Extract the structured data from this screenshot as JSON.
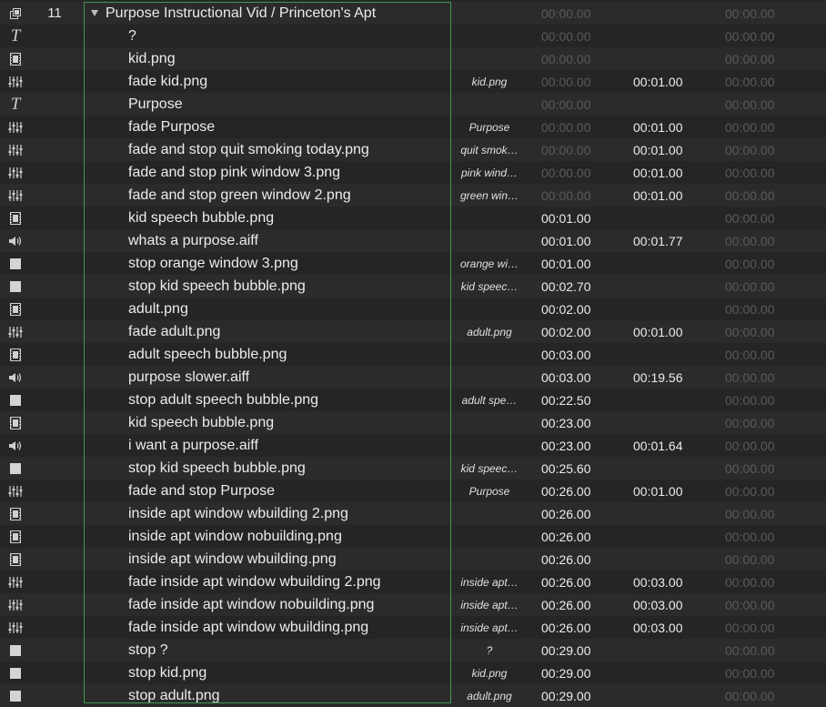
{
  "group_border_color": "#3f9a4e",
  "rows": [
    {
      "icon": "group-icon",
      "number": "11",
      "name": "Purpose Instructional Vid / Princeton's Apt",
      "target": "",
      "pre_wait": "00:00.00",
      "pre_dim": true,
      "action": "",
      "post_wait": "00:00.00",
      "post_dim": true,
      "group": true
    },
    {
      "icon": "text-icon",
      "number": "",
      "name": "?",
      "target": "",
      "pre_wait": "00:00.00",
      "pre_dim": true,
      "action": "",
      "post_wait": "00:00.00",
      "post_dim": true
    },
    {
      "icon": "video-icon",
      "number": "",
      "name": "kid.png",
      "target": "",
      "pre_wait": "00:00.00",
      "pre_dim": true,
      "action": "",
      "post_wait": "00:00.00",
      "post_dim": true
    },
    {
      "icon": "fade-icon",
      "number": "",
      "name": "fade kid.png",
      "target": "kid.png",
      "pre_wait": "00:00.00",
      "pre_dim": true,
      "action": "00:01.00",
      "post_wait": "00:00.00",
      "post_dim": true
    },
    {
      "icon": "text-icon",
      "number": "",
      "name": "Purpose",
      "target": "",
      "pre_wait": "00:00.00",
      "pre_dim": true,
      "action": "",
      "post_wait": "00:00.00",
      "post_dim": true
    },
    {
      "icon": "fade-icon",
      "number": "",
      "name": "fade Purpose",
      "target": "Purpose",
      "pre_wait": "00:00.00",
      "pre_dim": true,
      "action": "00:01.00",
      "post_wait": "00:00.00",
      "post_dim": true
    },
    {
      "icon": "fade-icon",
      "number": "",
      "name": "fade and stop quit smoking today.png",
      "target": "quit smok…",
      "pre_wait": "00:00.00",
      "pre_dim": true,
      "action": "00:01.00",
      "post_wait": "00:00.00",
      "post_dim": true
    },
    {
      "icon": "fade-icon",
      "number": "",
      "name": "fade and stop pink window 3.png",
      "target": "pink wind…",
      "pre_wait": "00:00.00",
      "pre_dim": true,
      "action": "00:01.00",
      "post_wait": "00:00.00",
      "post_dim": true
    },
    {
      "icon": "fade-icon",
      "number": "",
      "name": "fade and stop green window 2.png",
      "target": "green win…",
      "pre_wait": "00:00.00",
      "pre_dim": true,
      "action": "00:01.00",
      "post_wait": "00:00.00",
      "post_dim": true
    },
    {
      "icon": "video-icon",
      "number": "",
      "name": "kid speech bubble.png",
      "target": "",
      "pre_wait": "00:01.00",
      "pre_dim": false,
      "action": "",
      "post_wait": "00:00.00",
      "post_dim": true
    },
    {
      "icon": "audio-icon",
      "number": "",
      "name": "whats a purpose.aiff",
      "target": "",
      "pre_wait": "00:01.00",
      "pre_dim": false,
      "action": "00:01.77",
      "post_wait": "00:00.00",
      "post_dim": true
    },
    {
      "icon": "stop-icon",
      "number": "",
      "name": "stop orange window 3.png",
      "target": "orange wi…",
      "pre_wait": "00:01.00",
      "pre_dim": false,
      "action": "",
      "post_wait": "00:00.00",
      "post_dim": true
    },
    {
      "icon": "stop-icon",
      "number": "",
      "name": "stop kid speech bubble.png",
      "target": "kid speec…",
      "pre_wait": "00:02.70",
      "pre_dim": false,
      "action": "",
      "post_wait": "00:00.00",
      "post_dim": true
    },
    {
      "icon": "video-icon",
      "number": "",
      "name": "adult.png",
      "target": "",
      "pre_wait": "00:02.00",
      "pre_dim": false,
      "action": "",
      "post_wait": "00:00.00",
      "post_dim": true
    },
    {
      "icon": "fade-icon",
      "number": "",
      "name": "fade adult.png",
      "target": "adult.png",
      "pre_wait": "00:02.00",
      "pre_dim": false,
      "action": "00:01.00",
      "post_wait": "00:00.00",
      "post_dim": true
    },
    {
      "icon": "video-icon",
      "number": "",
      "name": "adult speech bubble.png",
      "target": "",
      "pre_wait": "00:03.00",
      "pre_dim": false,
      "action": "",
      "post_wait": "00:00.00",
      "post_dim": true
    },
    {
      "icon": "audio-icon",
      "number": "",
      "name": "purpose slower.aiff",
      "target": "",
      "pre_wait": "00:03.00",
      "pre_dim": false,
      "action": "00:19.56",
      "post_wait": "00:00.00",
      "post_dim": true
    },
    {
      "icon": "stop-icon",
      "number": "",
      "name": "stop adult speech bubble.png",
      "target": "adult spe…",
      "pre_wait": "00:22.50",
      "pre_dim": false,
      "action": "",
      "post_wait": "00:00.00",
      "post_dim": true
    },
    {
      "icon": "video-icon",
      "number": "",
      "name": "kid speech bubble.png",
      "target": "",
      "pre_wait": "00:23.00",
      "pre_dim": false,
      "action": "",
      "post_wait": "00:00.00",
      "post_dim": true
    },
    {
      "icon": "audio-icon",
      "number": "",
      "name": "i want a purpose.aiff",
      "target": "",
      "pre_wait": "00:23.00",
      "pre_dim": false,
      "action": "00:01.64",
      "post_wait": "00:00.00",
      "post_dim": true
    },
    {
      "icon": "stop-icon",
      "number": "",
      "name": "stop kid speech bubble.png",
      "target": "kid speec…",
      "pre_wait": "00:25.60",
      "pre_dim": false,
      "action": "",
      "post_wait": "00:00.00",
      "post_dim": true
    },
    {
      "icon": "fade-icon",
      "number": "",
      "name": "fade and stop Purpose",
      "target": "Purpose",
      "pre_wait": "00:26.00",
      "pre_dim": false,
      "action": "00:01.00",
      "post_wait": "00:00.00",
      "post_dim": true
    },
    {
      "icon": "video-icon",
      "number": "",
      "name": "inside apt window wbuilding 2.png",
      "target": "",
      "pre_wait": "00:26.00",
      "pre_dim": false,
      "action": "",
      "post_wait": "00:00.00",
      "post_dim": true
    },
    {
      "icon": "video-icon",
      "number": "",
      "name": "inside apt window nobuilding.png",
      "target": "",
      "pre_wait": "00:26.00",
      "pre_dim": false,
      "action": "",
      "post_wait": "00:00.00",
      "post_dim": true
    },
    {
      "icon": "video-icon",
      "number": "",
      "name": "inside apt window wbuilding.png",
      "target": "",
      "pre_wait": "00:26.00",
      "pre_dim": false,
      "action": "",
      "post_wait": "00:00.00",
      "post_dim": true
    },
    {
      "icon": "fade-icon",
      "number": "",
      "name": "fade inside apt window wbuilding 2.png",
      "target": "inside apt…",
      "pre_wait": "00:26.00",
      "pre_dim": false,
      "action": "00:03.00",
      "post_wait": "00:00.00",
      "post_dim": true
    },
    {
      "icon": "fade-icon",
      "number": "",
      "name": "fade inside apt window nobuilding.png",
      "target": "inside apt…",
      "pre_wait": "00:26.00",
      "pre_dim": false,
      "action": "00:03.00",
      "post_wait": "00:00.00",
      "post_dim": true
    },
    {
      "icon": "fade-icon",
      "number": "",
      "name": "fade inside apt window wbuilding.png",
      "target": "inside apt…",
      "pre_wait": "00:26.00",
      "pre_dim": false,
      "action": "00:03.00",
      "post_wait": "00:00.00",
      "post_dim": true
    },
    {
      "icon": "stop-icon",
      "number": "",
      "name": "stop ?",
      "target": "?",
      "pre_wait": "00:29.00",
      "pre_dim": false,
      "action": "",
      "post_wait": "00:00.00",
      "post_dim": true
    },
    {
      "icon": "stop-icon",
      "number": "",
      "name": "stop kid.png",
      "target": "kid.png",
      "pre_wait": "00:29.00",
      "pre_dim": false,
      "action": "",
      "post_wait": "00:00.00",
      "post_dim": true
    },
    {
      "icon": "stop-icon",
      "number": "",
      "name": "stop adult.png",
      "target": "adult.png",
      "pre_wait": "00:29.00",
      "pre_dim": false,
      "action": "",
      "post_wait": "00:00.00",
      "post_dim": true
    }
  ]
}
